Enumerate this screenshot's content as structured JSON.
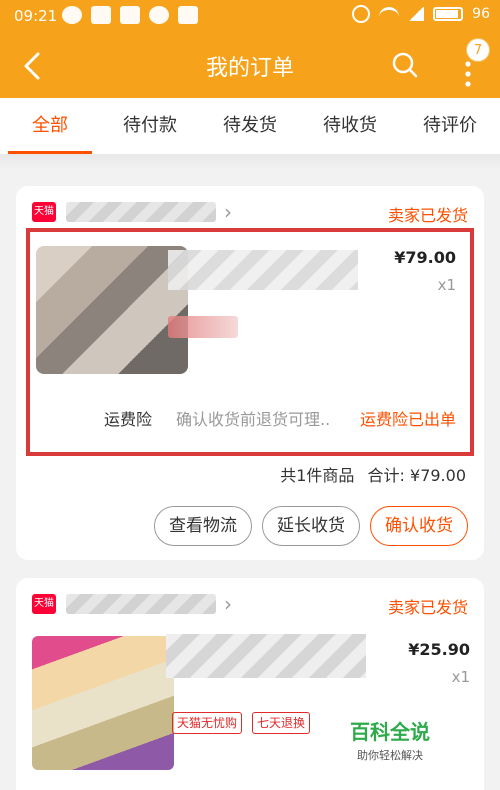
{
  "status_bar": {
    "time": "09:21",
    "battery": "96"
  },
  "header": {
    "title": "我的订单",
    "badge_count": "7"
  },
  "tabs": [
    {
      "label": "全部",
      "active": true
    },
    {
      "label": "待付款",
      "active": false
    },
    {
      "label": "待发货",
      "active": false
    },
    {
      "label": "待收货",
      "active": false
    },
    {
      "label": "待评价",
      "active": false
    }
  ],
  "orders": [
    {
      "shop_logo": "天猫",
      "status": "卖家已发货",
      "price": "¥79.00",
      "quantity": "x1",
      "insurance_label": "运费险",
      "insurance_desc": "确认收货前退货可理..",
      "insurance_status": "运费险已出单",
      "summary_count": "共1件商品",
      "summary_total_label": "合计:",
      "summary_total": "¥79.00",
      "buttons": {
        "logistics": "查看物流",
        "extend": "延长收货",
        "confirm": "确认收货"
      }
    },
    {
      "shop_logo": "天猫",
      "status": "卖家已发货",
      "price": "¥25.90",
      "quantity": "x1",
      "tags": [
        "天猫无忧购",
        "七天退换"
      ]
    }
  ],
  "watermark": {
    "main": "百科全说",
    "sub": "助你轻松解决"
  },
  "colors": {
    "header_bg": "#f7a21b",
    "accent": "#ff5000",
    "highlight_border": "#d93a3a"
  }
}
